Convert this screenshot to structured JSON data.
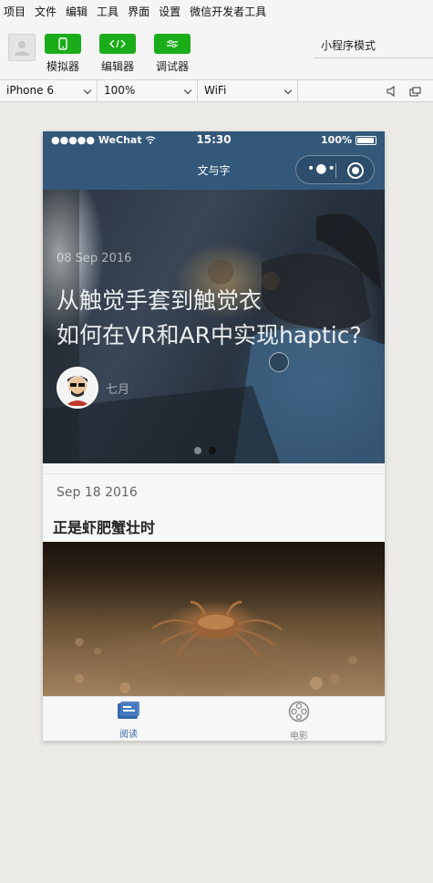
{
  "menu": [
    "项目",
    "文件",
    "编辑",
    "工具",
    "界面",
    "设置",
    "微信开发者工具"
  ],
  "toolbar": {
    "simulator_label": "模拟器",
    "editor_label": "编辑器",
    "debugger_label": "调试器",
    "mode": "小程序模式"
  },
  "device_bar": {
    "device": "iPhone 6",
    "zoom": "100%",
    "network": "WiFi"
  },
  "phone": {
    "status": {
      "carrier": "●●●●● WeChat",
      "time": "15:30",
      "battery": "100%"
    },
    "nav_title": "文与字",
    "capsule_dots": "•●•",
    "banner": {
      "date": "08 Sep 2016",
      "title_line1": "从触觉手套到触觉衣",
      "title_line2": "如何在VR和AR中实现haptic?",
      "author": "七月",
      "slide_count": 2,
      "active_slide": 2
    },
    "post": {
      "date": "Sep 18 2016",
      "title": "正是虾肥蟹壮时"
    },
    "tabs": [
      {
        "label": "阅读",
        "icon": "reading-icon",
        "active": true,
        "color": "#3366aa"
      },
      {
        "label": "电影",
        "icon": "film-reel-icon",
        "active": false,
        "color": "#888888"
      }
    ]
  },
  "colors": {
    "accent_green": "#1aad19",
    "nav_blue": "#33587a"
  }
}
